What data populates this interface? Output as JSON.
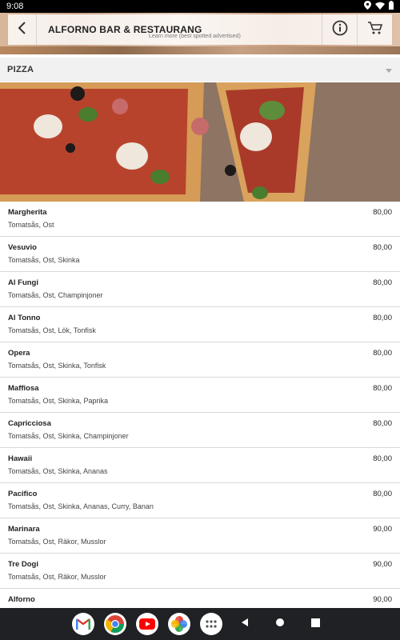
{
  "status_bar": {
    "time": "9:08"
  },
  "header": {
    "title": "ALFORNO BAR & RESTAURANG",
    "ad_note": "Learn more (best spotted advertised)"
  },
  "category": {
    "title": "PIZZA"
  },
  "menu": {
    "items": [
      {
        "name": "Margherita",
        "desc": "Tomatsås, Ost",
        "price": "80,00"
      },
      {
        "name": "Vesuvio",
        "desc": "Tomatsås, Ost, Skinka",
        "price": "80,00"
      },
      {
        "name": "Al Fungi",
        "desc": "Tomatsås, Ost, Champinjoner",
        "price": "80,00"
      },
      {
        "name": "Al Tonno",
        "desc": "Tomatsås, Ost, Lök, Tonfisk",
        "price": "80,00"
      },
      {
        "name": "Opera",
        "desc": "Tomatsås, Ost, Skinka, Tonfisk",
        "price": "80,00"
      },
      {
        "name": "Maffiosa",
        "desc": "Tomatsås, Ost, Skinka, Paprika",
        "price": "80,00"
      },
      {
        "name": "Capricciosa",
        "desc": "Tomatsås, Ost, Skinka, Champinjoner",
        "price": "80,00"
      },
      {
        "name": "Hawaii",
        "desc": "Tomatsås, Ost, Skinka, Ananas",
        "price": "80,00"
      },
      {
        "name": "Pacifico",
        "desc": "Tomatsås, Ost, Skinka, Ananas, Curry, Banan",
        "price": "80,00"
      },
      {
        "name": "Marinara",
        "desc": "Tomatsås, Ost, Räkor, Musslor",
        "price": "90,00"
      },
      {
        "name": "Tre Dogi",
        "desc": "Tomatsås, Ost, Räkor, Musslor",
        "price": "90,00"
      },
      {
        "name": "Alforno",
        "desc": "",
        "price": "90,00"
      }
    ]
  },
  "icons": {
    "back": "chevron-left-icon",
    "info": "info-icon",
    "cart": "cart-icon",
    "category_toggle": "dropdown-triangle-icon",
    "dock": [
      "gmail-icon",
      "chrome-icon",
      "youtube-icon",
      "photos-icon",
      "app-drawer-icon"
    ],
    "system": [
      "back-triangle-icon",
      "home-circle-icon",
      "recents-square-icon"
    ]
  }
}
